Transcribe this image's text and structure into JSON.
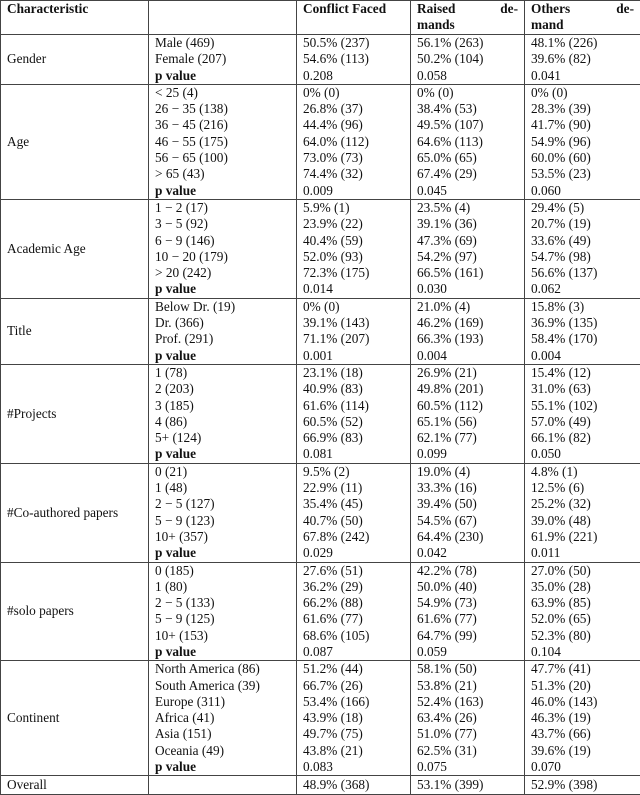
{
  "header": {
    "characteristic": "Characteristic",
    "subgroup": "",
    "col1": "Conflict Faced",
    "col2_line1a": "Raised",
    "col2_line1b": "de-",
    "col2_line2": "mands",
    "col3_line1a": "Others",
    "col3_line1b": "de-",
    "col3_line2": "mand"
  },
  "groups": [
    {
      "name": "Gender",
      "rows": [
        {
          "label": "Male (469)",
          "c1": "50.5% (237)",
          "c2": "56.1% (263)",
          "c3": "48.1% (226)"
        },
        {
          "label": "Female (207)",
          "c1": "54.6% (113)",
          "c2": "50.2% (104)",
          "c3": "39.6% (82)"
        }
      ],
      "p": {
        "label": "p value",
        "c1": "0.208",
        "c2": "0.058",
        "c3": "0.041"
      }
    },
    {
      "name": "Age",
      "rows": [
        {
          "label": "< 25 (4)",
          "c1": "0% (0)",
          "c2": "0% (0)",
          "c3": "0% (0)"
        },
        {
          "label": "26 − 35 (138)",
          "c1": "26.8% (37)",
          "c2": "38.4% (53)",
          "c3": "28.3% (39)"
        },
        {
          "label": "36 − 45 (216)",
          "c1": "44.4% (96)",
          "c2": "49.5% (107)",
          "c3": "41.7% (90)"
        },
        {
          "label": "46 − 55 (175)",
          "c1": "64.0% (112)",
          "c2": "64.6% (113)",
          "c3": "54.9% (96)"
        },
        {
          "label": "56 − 65 (100)",
          "c1": "73.0% (73)",
          "c2": "65.0% (65)",
          "c3": "60.0% (60)"
        },
        {
          "label": "> 65 (43)",
          "c1": "74.4% (32)",
          "c2": "67.4% (29)",
          "c3": "53.5% (23)"
        }
      ],
      "p": {
        "label": "p value",
        "c1": "0.009",
        "c2": "0.045",
        "c3": "0.060"
      }
    },
    {
      "name": "Academic Age",
      "rows": [
        {
          "label": "1 − 2 (17)",
          "c1": "5.9% (1)",
          "c2": "23.5% (4)",
          "c3": "29.4% (5)"
        },
        {
          "label": "3 − 5 (92)",
          "c1": "23.9% (22)",
          "c2": "39.1% (36)",
          "c3": "20.7% (19)"
        },
        {
          "label": "6 − 9 (146)",
          "c1": "40.4% (59)",
          "c2": "47.3% (69)",
          "c3": "33.6% (49)"
        },
        {
          "label": "10 − 20 (179)",
          "c1": "52.0% (93)",
          "c2": "54.2% (97)",
          "c3": "54.7% (98)"
        },
        {
          "label": "> 20 (242)",
          "c1": "72.3% (175)",
          "c2": "66.5% (161)",
          "c3": "56.6% (137)"
        }
      ],
      "p": {
        "label": "p value",
        "c1": "0.014",
        "c2": "0.030",
        "c3": "0.062"
      }
    },
    {
      "name": "Title",
      "rows": [
        {
          "label": "Below Dr. (19)",
          "c1": "0% (0)",
          "c2": "21.0% (4)",
          "c3": "15.8% (3)"
        },
        {
          "label": "Dr. (366)",
          "c1": "39.1% (143)",
          "c2": "46.2% (169)",
          "c3": "36.9% (135)"
        },
        {
          "label": "Prof. (291)",
          "c1": "71.1% (207)",
          "c2": "66.3% (193)",
          "c3": "58.4% (170)"
        }
      ],
      "p": {
        "label": "p value",
        "c1": "0.001",
        "c2": "0.004",
        "c3": "0.004"
      }
    },
    {
      "name": "#Projects",
      "rows": [
        {
          "label": "1 (78)",
          "c1": "23.1% (18)",
          "c2": "26.9% (21)",
          "c3": "15.4% (12)"
        },
        {
          "label": "2 (203)",
          "c1": "40.9% (83)",
          "c2": "49.8% (201)",
          "c3": "31.0% (63)"
        },
        {
          "label": "3 (185)",
          "c1": "61.6% (114)",
          "c2": "60.5% (112)",
          "c3": "55.1% (102)"
        },
        {
          "label": "4 (86)",
          "c1": "60.5% (52)",
          "c2": "65.1% (56)",
          "c3": "57.0% (49)"
        },
        {
          "label": "5+ (124)",
          "c1": "66.9% (83)",
          "c2": "62.1% (77)",
          "c3": "66.1% (82)"
        }
      ],
      "p": {
        "label": "p value",
        "c1": "0.081",
        "c2": "0.099",
        "c3": "0.050"
      }
    },
    {
      "name": "#Co-authored papers",
      "rows": [
        {
          "label": "0 (21)",
          "c1": "9.5% (2)",
          "c2": "19.0% (4)",
          "c3": "4.8% (1)"
        },
        {
          "label": "1 (48)",
          "c1": "22.9% (11)",
          "c2": "33.3% (16)",
          "c3": "12.5% (6)"
        },
        {
          "label": "2 − 5 (127)",
          "c1": "35.4% (45)",
          "c2": "39.4% (50)",
          "c3": "25.2% (32)"
        },
        {
          "label": "5 − 9 (123)",
          "c1": "40.7% (50)",
          "c2": "54.5% (67)",
          "c3": "39.0% (48)"
        },
        {
          "label": "10+ (357)",
          "c1": "67.8% (242)",
          "c2": "64.4% (230)",
          "c3": "61.9% (221)"
        }
      ],
      "p": {
        "label": "p value",
        "c1": "0.029",
        "c2": "0.042",
        "c3": "0.011"
      }
    },
    {
      "name": "#solo papers",
      "rows": [
        {
          "label": "0 (185)",
          "c1": "27.6% (51)",
          "c2": "42.2% (78)",
          "c3": "27.0% (50)"
        },
        {
          "label": "1 (80)",
          "c1": "36.2% (29)",
          "c2": "50.0% (40)",
          "c3": "35.0% (28)"
        },
        {
          "label": "2 − 5 (133)",
          "c1": "66.2% (88)",
          "c2": "54.9% (73)",
          "c3": "63.9% (85)"
        },
        {
          "label": "5 − 9 (125)",
          "c1": "61.6% (77)",
          "c2": "61.6% (77)",
          "c3": "52.0% (65)"
        },
        {
          "label": "10+ (153)",
          "c1": "68.6% (105)",
          "c2": "64.7% (99)",
          "c3": "52.3% (80)"
        }
      ],
      "p": {
        "label": "p value",
        "c1": "0.087",
        "c2": "0.059",
        "c3": "0.104"
      }
    },
    {
      "name": "Continent",
      "rows": [
        {
          "label": "North America (86)",
          "c1": "51.2% (44)",
          "c2": "58.1% (50)",
          "c3": "47.7% (41)"
        },
        {
          "label": "South America (39)",
          "c1": "66.7% (26)",
          "c2": "53.8% (21)",
          "c3": "51.3% (20)"
        },
        {
          "label": "Europe (311)",
          "c1": "53.4% (166)",
          "c2": "52.4% (163)",
          "c3": "46.0% (143)"
        },
        {
          "label": "Africa (41)",
          "c1": "43.9% (18)",
          "c2": "63.4% (26)",
          "c3": "46.3% (19)"
        },
        {
          "label": "Asia (151)",
          "c1": "49.7% (75)",
          "c2": "51.0% (77)",
          "c3": "43.7% (66)"
        },
        {
          "label": "Oceania (49)",
          "c1": "43.8% (21)",
          "c2": "62.5% (31)",
          "c3": "39.6% (19)"
        }
      ],
      "p": {
        "label": "p value",
        "c1": "0.083",
        "c2": "0.075",
        "c3": "0.070"
      }
    }
  ],
  "overall": {
    "label": "Overall",
    "sub": "",
    "c1": "48.9% (368)",
    "c2": "53.1% (399)",
    "c3": "52.9% (398)"
  }
}
